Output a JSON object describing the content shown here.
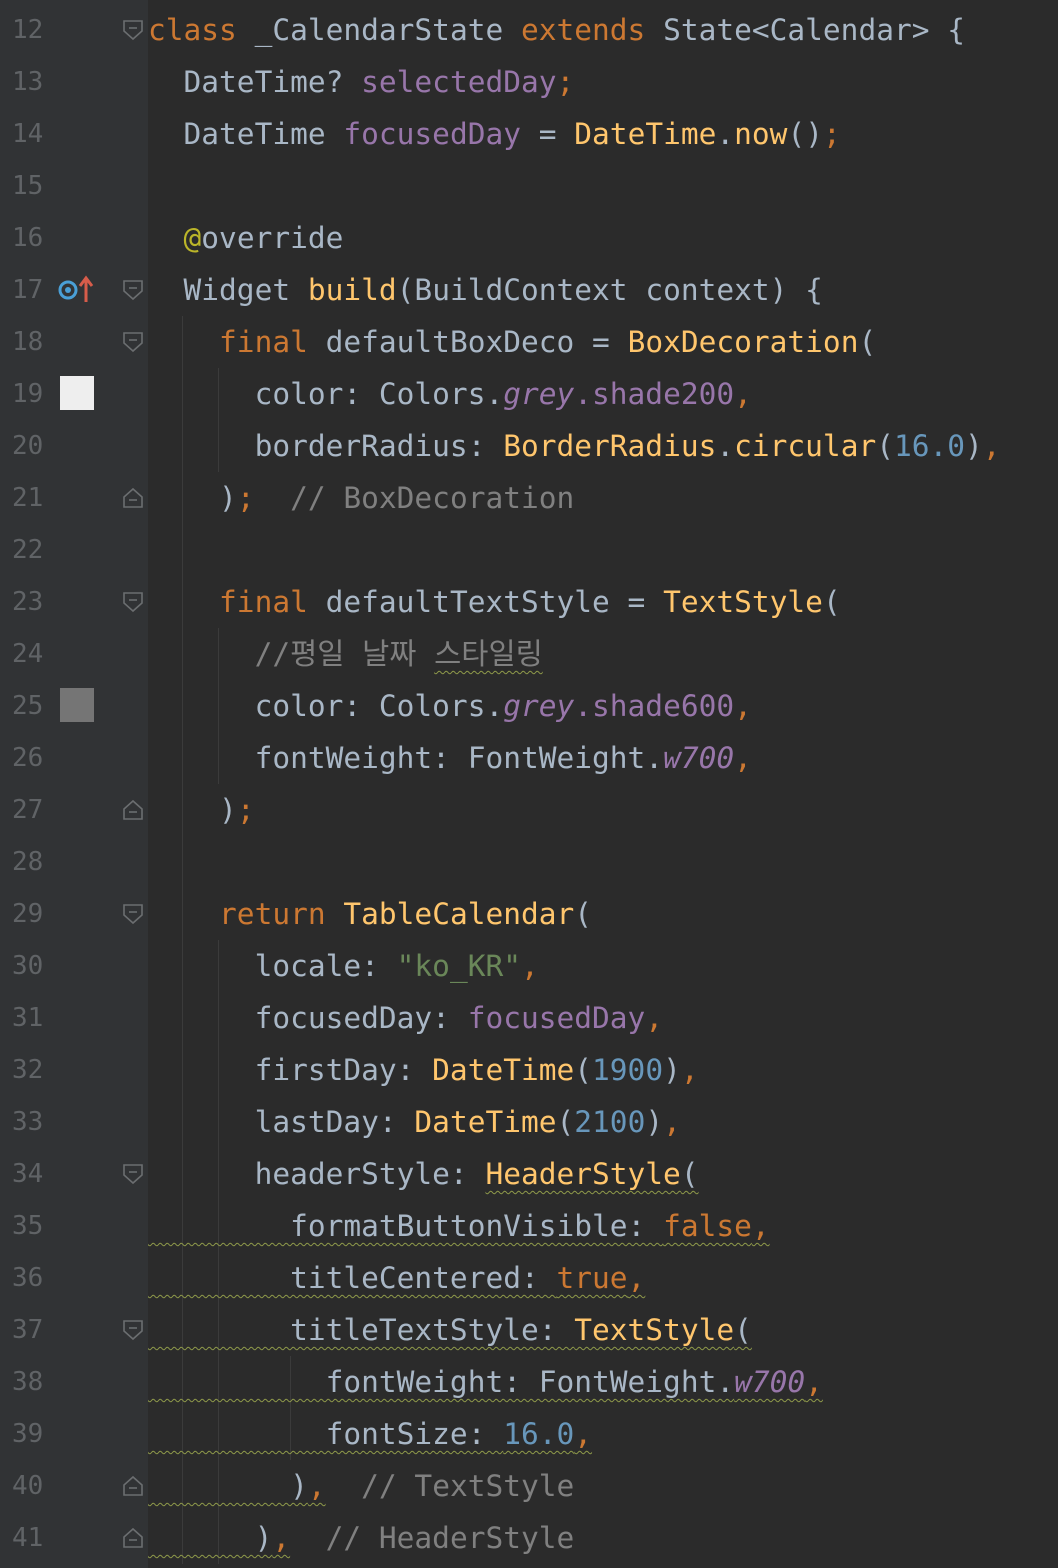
{
  "editor": {
    "language": "Dart",
    "lines": [
      {
        "number": "12",
        "tokens": [
          {
            "t": "class",
            "c": "k"
          },
          {
            "t": " _CalendarState ",
            "c": "t"
          },
          {
            "t": "extends",
            "c": "k"
          },
          {
            "t": " State<Calendar> {",
            "c": "t"
          }
        ]
      },
      {
        "number": "13",
        "tokens": [
          {
            "t": "  DateTime? ",
            "c": "t"
          },
          {
            "t": "selectedDay",
            "c": "p"
          },
          {
            "t": ";",
            "c": "k"
          }
        ]
      },
      {
        "number": "14",
        "tokens": [
          {
            "t": "  DateTime ",
            "c": "t"
          },
          {
            "t": "focusedDay",
            "c": "p"
          },
          {
            "t": " = ",
            "c": "t"
          },
          {
            "t": "DateTime",
            "c": "f"
          },
          {
            "t": ".",
            "c": "t"
          },
          {
            "t": "now",
            "c": "f"
          },
          {
            "t": "()",
            "c": "t"
          },
          {
            "t": ";",
            "c": "k"
          }
        ]
      },
      {
        "number": "15",
        "tokens": []
      },
      {
        "number": "16",
        "tokens": [
          {
            "t": "  ",
            "c": "t"
          },
          {
            "t": "@",
            "c": "a"
          },
          {
            "t": "override",
            "c": "t"
          }
        ]
      },
      {
        "number": "17",
        "tokens": [
          {
            "t": "  Widget ",
            "c": "t"
          },
          {
            "t": "build",
            "c": "f"
          },
          {
            "t": "(BuildContext context) {",
            "c": "t"
          }
        ]
      },
      {
        "number": "18",
        "tokens": [
          {
            "t": "    ",
            "c": "t"
          },
          {
            "t": "final",
            "c": "k"
          },
          {
            "t": " defaultBoxDeco = ",
            "c": "t"
          },
          {
            "t": "BoxDecoration",
            "c": "f"
          },
          {
            "t": "(",
            "c": "t"
          }
        ]
      },
      {
        "number": "19",
        "tokens": [
          {
            "t": "      color: Colors.",
            "c": "t"
          },
          {
            "t": "grey",
            "c": "i"
          },
          {
            "t": ".shade200",
            "c": "p"
          },
          {
            "t": ",",
            "c": "k"
          }
        ]
      },
      {
        "number": "20",
        "tokens": [
          {
            "t": "      borderRadius: ",
            "c": "t"
          },
          {
            "t": "BorderRadius",
            "c": "f"
          },
          {
            "t": ".",
            "c": "t"
          },
          {
            "t": "circular",
            "c": "f"
          },
          {
            "t": "(",
            "c": "t"
          },
          {
            "t": "16.0",
            "c": "n"
          },
          {
            "t": ")",
            "c": "t"
          },
          {
            "t": ",",
            "c": "k"
          }
        ]
      },
      {
        "number": "21",
        "tokens": [
          {
            "t": "    )",
            "c": "t"
          },
          {
            "t": ";",
            "c": "k"
          },
          {
            "t": "  // BoxDecoration",
            "c": "c"
          }
        ]
      },
      {
        "number": "22",
        "tokens": []
      },
      {
        "number": "23",
        "tokens": [
          {
            "t": "    ",
            "c": "t"
          },
          {
            "t": "final",
            "c": "k"
          },
          {
            "t": " defaultTextStyle = ",
            "c": "t"
          },
          {
            "t": "TextStyle",
            "c": "f"
          },
          {
            "t": "(",
            "c": "t"
          }
        ]
      },
      {
        "number": "24",
        "tokens": [
          {
            "t": "      //평일 날짜 ",
            "c": "c"
          },
          {
            "t": "스타일링",
            "c": "c",
            "sq": true
          }
        ]
      },
      {
        "number": "25",
        "tokens": [
          {
            "t": "      color: Colors.",
            "c": "t"
          },
          {
            "t": "grey",
            "c": "i"
          },
          {
            "t": ".shade600",
            "c": "p"
          },
          {
            "t": ",",
            "c": "k"
          }
        ]
      },
      {
        "number": "26",
        "tokens": [
          {
            "t": "      fontWeight: FontWeight.",
            "c": "t"
          },
          {
            "t": "w700",
            "c": "i"
          },
          {
            "t": ",",
            "c": "k"
          }
        ]
      },
      {
        "number": "27",
        "tokens": [
          {
            "t": "    )",
            "c": "t"
          },
          {
            "t": ";",
            "c": "k"
          }
        ]
      },
      {
        "number": "28",
        "tokens": []
      },
      {
        "number": "29",
        "tokens": [
          {
            "t": "    ",
            "c": "t"
          },
          {
            "t": "return",
            "c": "k"
          },
          {
            "t": " ",
            "c": "t"
          },
          {
            "t": "TableCalendar",
            "c": "f"
          },
          {
            "t": "(",
            "c": "t"
          }
        ]
      },
      {
        "number": "30",
        "tokens": [
          {
            "t": "      locale: ",
            "c": "t"
          },
          {
            "t": "\"ko_KR\"",
            "c": "s"
          },
          {
            "t": ",",
            "c": "k"
          }
        ]
      },
      {
        "number": "31",
        "tokens": [
          {
            "t": "      focusedDay: ",
            "c": "t"
          },
          {
            "t": "focusedDay",
            "c": "p"
          },
          {
            "t": ",",
            "c": "k"
          }
        ]
      },
      {
        "number": "32",
        "tokens": [
          {
            "t": "      firstDay: ",
            "c": "t"
          },
          {
            "t": "DateTime",
            "c": "f"
          },
          {
            "t": "(",
            "c": "t"
          },
          {
            "t": "1900",
            "c": "n"
          },
          {
            "t": ")",
            "c": "t"
          },
          {
            "t": ",",
            "c": "k"
          }
        ]
      },
      {
        "number": "33",
        "tokens": [
          {
            "t": "      lastDay: ",
            "c": "t"
          },
          {
            "t": "DateTime",
            "c": "f"
          },
          {
            "t": "(",
            "c": "t"
          },
          {
            "t": "2100",
            "c": "n"
          },
          {
            "t": ")",
            "c": "t"
          },
          {
            "t": ",",
            "c": "k"
          }
        ]
      },
      {
        "number": "34",
        "tokens": [
          {
            "t": "      headerStyle: ",
            "c": "t"
          },
          {
            "t": "HeaderStyle",
            "c": "f",
            "sq": true
          },
          {
            "t": "(",
            "c": "t",
            "sq": true
          }
        ]
      },
      {
        "number": "35",
        "tokens": [
          {
            "t": "        formatButtonVisible: ",
            "c": "t",
            "sq": true,
            "lead": true
          },
          {
            "t": "false",
            "c": "k",
            "sq": true
          },
          {
            "t": ",",
            "c": "k",
            "sq": true
          }
        ]
      },
      {
        "number": "36",
        "tokens": [
          {
            "t": "        titleCentered: ",
            "c": "t",
            "sq": true,
            "lead": true
          },
          {
            "t": "true",
            "c": "k",
            "sq": true
          },
          {
            "t": ",",
            "c": "k",
            "sq": true
          }
        ]
      },
      {
        "number": "37",
        "tokens": [
          {
            "t": "        titleTextStyle: ",
            "c": "t",
            "sq": true,
            "lead": true
          },
          {
            "t": "TextStyle",
            "c": "f",
            "sq": true
          },
          {
            "t": "(",
            "c": "t",
            "sq": true
          }
        ]
      },
      {
        "number": "38",
        "tokens": [
          {
            "t": "          fontWeight: FontWeight.",
            "c": "t",
            "sq": true,
            "lead": true
          },
          {
            "t": "w700",
            "c": "i",
            "sq": true
          },
          {
            "t": ",",
            "c": "k",
            "sq": true
          }
        ]
      },
      {
        "number": "39",
        "tokens": [
          {
            "t": "          fontSize: ",
            "c": "t",
            "sq": true,
            "lead": true
          },
          {
            "t": "16.0",
            "c": "n",
            "sq": true
          },
          {
            "t": ",",
            "c": "k",
            "sq": true
          }
        ]
      },
      {
        "number": "40",
        "tokens": [
          {
            "t": "        )",
            "c": "t",
            "sq": true,
            "lead": true
          },
          {
            "t": ",",
            "c": "k",
            "sq": true
          },
          {
            "t": "  // TextStyle",
            "c": "c"
          }
        ]
      },
      {
        "number": "41",
        "tokens": [
          {
            "t": "      )",
            "c": "t",
            "sq": true,
            "lead": true
          },
          {
            "t": ",",
            "c": "k",
            "sq": true
          },
          {
            "t": "  // HeaderStyle",
            "c": "c"
          }
        ]
      }
    ],
    "fold_markers": [
      {
        "line": "12",
        "kind": "open"
      },
      {
        "line": "17",
        "kind": "open"
      },
      {
        "line": "18",
        "kind": "open"
      },
      {
        "line": "21",
        "kind": "close"
      },
      {
        "line": "23",
        "kind": "open"
      },
      {
        "line": "27",
        "kind": "close"
      },
      {
        "line": "29",
        "kind": "open"
      },
      {
        "line": "34",
        "kind": "open"
      },
      {
        "line": "37",
        "kind": "open"
      },
      {
        "line": "40",
        "kind": "close"
      },
      {
        "line": "41",
        "kind": "close"
      }
    ],
    "color_swatches": [
      {
        "line": "19",
        "color": "#eeeeee",
        "name": "grey-shade200-swatch"
      },
      {
        "line": "25",
        "color": "#757575",
        "name": "grey-shade600-swatch"
      }
    ],
    "override_marker_line": "17",
    "colors": {
      "background": "#2b2b2b",
      "gutter": "#313335",
      "line_number": "#606366",
      "keyword": "#cc7832",
      "function": "#ffc66d",
      "field": "#9876aa",
      "number": "#6897bb",
      "string": "#6a8759",
      "comment": "#808080",
      "annotation": "#bbb529",
      "default": "#a9b7c6"
    }
  }
}
